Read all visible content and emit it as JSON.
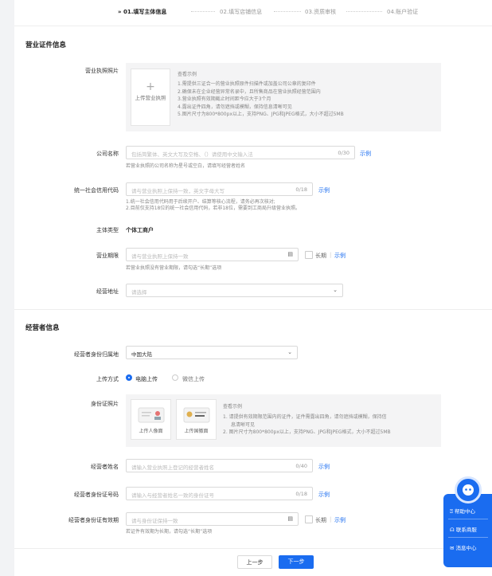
{
  "steps": [
    "» 01.填写主体信息",
    "02.填写店铺信息",
    "03.资质审核",
    "04.账户验证"
  ],
  "business_section": {
    "title": "营业证件信息",
    "license_photo": {
      "label": "营业执照照片",
      "upload_label": "上传营业执照",
      "example_link": "查看示例",
      "notes": [
        "1.需提供三证合一的营业执照原件扫描件或加盖公司公章的复印件",
        "2.确保未在企业经营异常名录中，且所售商品在营业执照经营范围内",
        "3.营业执照有效期截止时间距今应大于3个月",
        "4.露出证件四角，请勿遮挡或模糊，保持信息清晰可见",
        "5.图片尺寸为800*800px以上，支持PNG、JPG和JPEG格式，大小不超过5MB"
      ]
    },
    "company_name": {
      "label": "公司名称",
      "placeholder": "包括简繁体、英文大写及空格、（）请使用中文输入法",
      "count": "0/30",
      "example": "示例",
      "hint": "若营业执照的公司名称为星号或空白，请填写经营者姓名"
    },
    "credit_code": {
      "label": "统一社会信用代码",
      "placeholder": "请与营业执照上保持一致，英文字母大写",
      "count": "0/18",
      "example": "示例",
      "hint1": "1.统一社会信用代码用于后续开户、结算等核心流程，请务必再次核对;",
      "hint2": "2.目前仅支持18位的统一社会信用代码，若非18位，需要到工商局升级营业执照。"
    },
    "entity_type": {
      "label": "主体类型",
      "value": "个体工商户"
    },
    "business_term": {
      "label": "营业期限",
      "placeholder": "请与营业执照上保持一致",
      "long_term": "长期",
      "sep": "|",
      "example": "示例",
      "hint": "若营业执照没有营业期限，请勾选“长期”选项"
    },
    "address": {
      "label": "经营地址",
      "placeholder": "请选择"
    }
  },
  "operator_section": {
    "title": "经营者信息",
    "id_region": {
      "label": "经营者身份归属地",
      "value": "中国大陆"
    },
    "upload_method": {
      "label": "上传方式",
      "option1": "电脑上传",
      "option2": "微信上传"
    },
    "id_photo": {
      "label": "身份证照片",
      "portrait": "上传人像面",
      "emblem": "上传国徽面",
      "example_link": "查看示例",
      "note1a": "1. 请提供有效期限范围内的证件，证件需露出四角，请勿遮挡或模糊，保持信",
      "note1b": "息清晰可见",
      "note2": "2. 图片尺寸为800*800px以上，支持PNG、JPG和JPEG格式，大小不超过5MB"
    },
    "name": {
      "label": "经营者姓名",
      "placeholder": "请输入营业执照上登记的经营者姓名",
      "count": "0/40",
      "example": "示例"
    },
    "id_number": {
      "label": "经营者身份证号码",
      "placeholder": "请输入与经营者姓名一致的身份证号",
      "count": "0/18",
      "example": "示例"
    },
    "id_validity": {
      "label": "经营者身份证有效期",
      "placeholder": "请与身份证保持一致",
      "long_term": "长期",
      "sep": "|",
      "example": "示例",
      "hint": "若证件有效期为长期，请勾选“长期”选项"
    }
  },
  "footer": {
    "prev": "上一步",
    "next": "下一步"
  },
  "float_menu": {
    "help": "帮助中心",
    "service": "联系商服",
    "messages": "消息中心"
  },
  "colors": {
    "primary": "#1a6cf0"
  }
}
